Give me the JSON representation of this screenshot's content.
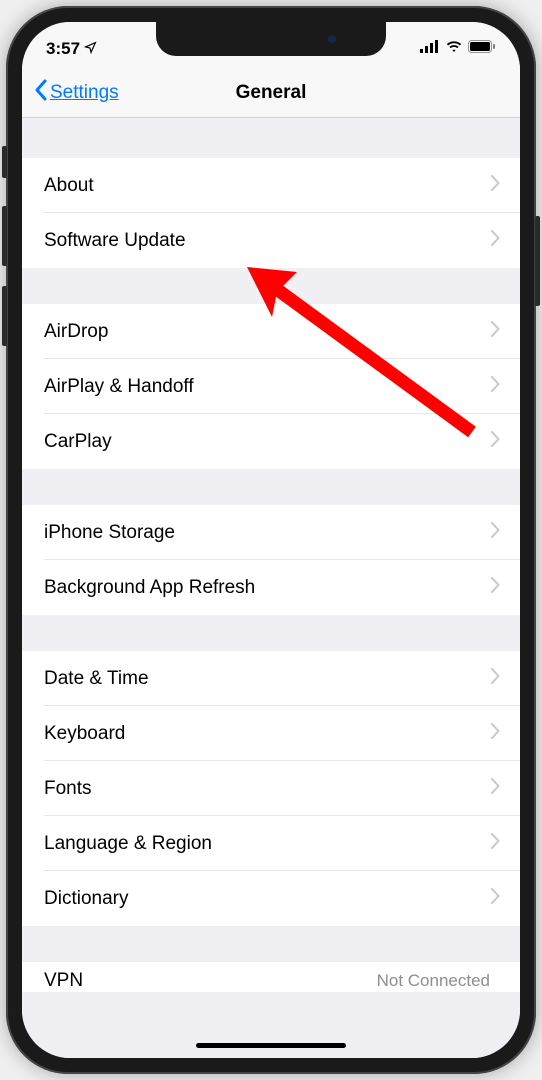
{
  "status": {
    "time": "3:57",
    "location_icon": "location-arrow",
    "signal_icon": "cellular-signal",
    "wifi_icon": "wifi",
    "battery_icon": "battery"
  },
  "nav": {
    "back_label": "Settings",
    "title": "General"
  },
  "groups": [
    {
      "rows": [
        {
          "label": "About"
        },
        {
          "label": "Software Update"
        }
      ]
    },
    {
      "rows": [
        {
          "label": "AirDrop"
        },
        {
          "label": "AirPlay & Handoff"
        },
        {
          "label": "CarPlay"
        }
      ]
    },
    {
      "rows": [
        {
          "label": "iPhone Storage"
        },
        {
          "label": "Background App Refresh"
        }
      ]
    },
    {
      "rows": [
        {
          "label": "Date & Time"
        },
        {
          "label": "Keyboard"
        },
        {
          "label": "Fonts"
        },
        {
          "label": "Language & Region"
        },
        {
          "label": "Dictionary"
        }
      ]
    }
  ],
  "partial": {
    "label": "VPN",
    "detail": "Not Connected"
  },
  "annotation": {
    "type": "red-arrow",
    "points_to": "Software Update"
  }
}
